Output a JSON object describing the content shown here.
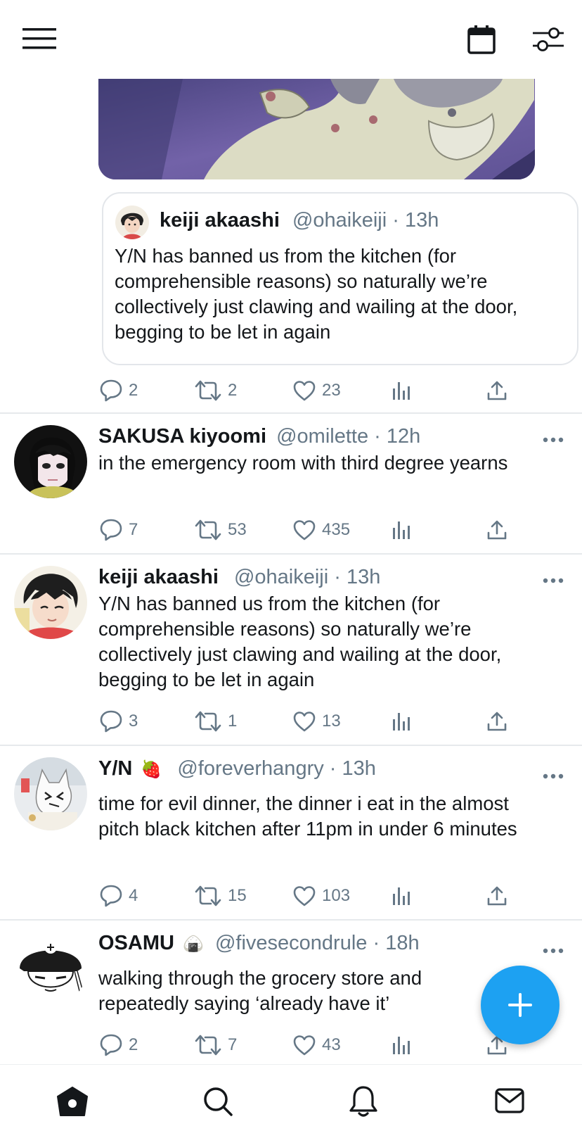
{
  "quoted_tweet": {
    "name": "keiji akaashi",
    "handle": "@ohaikeiji",
    "time": "13h",
    "text": "Y/N has banned us from the kitchen (for comprehensible reasons) so naturally we’re collectively just clawing and wailing at the door, begging to be let in again"
  },
  "media_tweet_actions": {
    "replies": "2",
    "retweets": "2",
    "likes": "23"
  },
  "tweets": [
    {
      "name": "SAKUSA kiyoomi",
      "emoji": "",
      "handle": "@omilette",
      "time": "12h",
      "text": "in the emergency room with third degree yearns",
      "replies": "7",
      "retweets": "53",
      "likes": "435"
    },
    {
      "name": "keiji akaashi",
      "emoji": "",
      "handle": "@ohaikeiji",
      "time": "13h",
      "text": "Y/N has banned us from the kitchen (for comprehensible reasons) so naturally we’re collectively just clawing and wailing at the door, begging to be let in again",
      "replies": "3",
      "retweets": "1",
      "likes": "13"
    },
    {
      "name": "Y/N",
      "emoji": "🍓",
      "handle": "@foreverhangry",
      "time": "13h",
      "text": "time for evil dinner, the dinner i eat in the almost pitch black kitchen after 11pm in under 6 minutes",
      "replies": "4",
      "retweets": "15",
      "likes": "103"
    },
    {
      "name": "OSAMU",
      "emoji": "🍙",
      "handle": "@fivesecondrule",
      "time": "18h",
      "text": "walking through the grocery store and repeatedly saying ‘already have it’",
      "replies": "2",
      "retweets": "7",
      "likes": "43"
    }
  ],
  "colors": {
    "accent": "#1da1f2",
    "secondary_text": "#657786",
    "text": "#14171a"
  },
  "icons": {
    "topbar": [
      "menu-icon",
      "calendar-icon",
      "filter-icon"
    ],
    "bottombar": [
      "home-icon",
      "search-icon",
      "notifications-icon",
      "messages-icon"
    ],
    "fab": "plus-icon"
  }
}
